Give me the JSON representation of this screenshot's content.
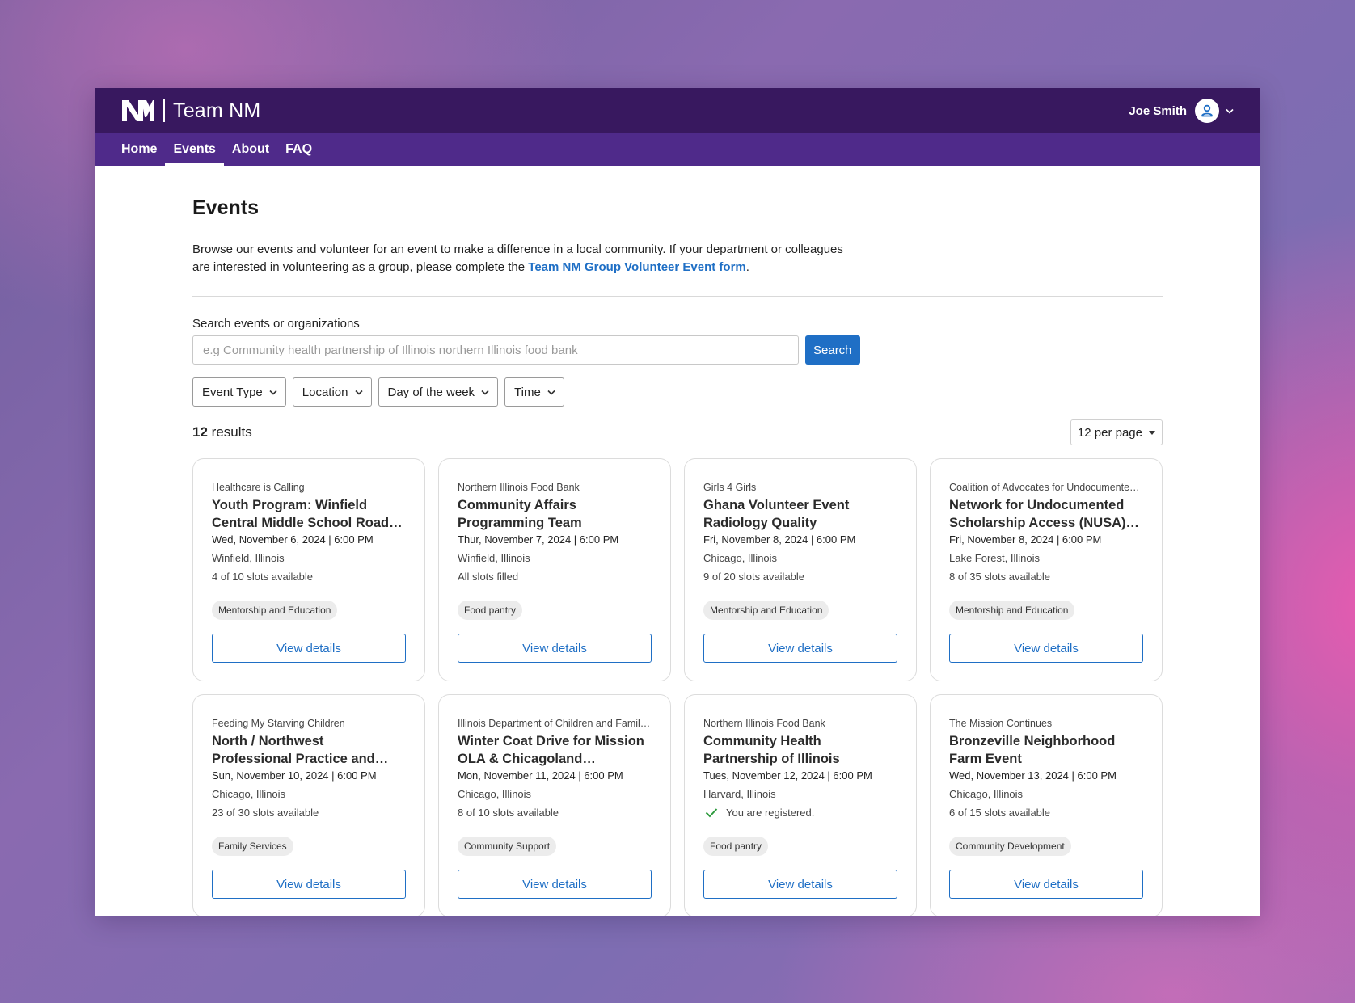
{
  "header": {
    "brand": "Team NM",
    "user_name": "Joe Smith"
  },
  "nav": [
    "Home",
    "Events",
    "About",
    "FAQ"
  ],
  "nav_active": "Events",
  "page": {
    "title": "Events",
    "intro_text": "Browse our events and volunteer for an event to make a difference in a local community. If your department or colleagues are interested in volunteering as a group, please complete the ",
    "intro_link": "Team NM Group Volunteer Event form",
    "intro_end": "."
  },
  "search": {
    "label": "Search events or organizations",
    "placeholder": "e.g Community health partnership of Illinois northern Illinois food bank",
    "button": "Search"
  },
  "filters": [
    "Event Type",
    "Location",
    "Day of the week",
    "Time"
  ],
  "results": {
    "count": "12",
    "label": "results",
    "per_page": "12 per page"
  },
  "events": [
    {
      "org": "Healthcare is Calling",
      "title": "Youth Program: Winfield Central Middle School Roads to Success Mentorship",
      "date": "Wed, November 6, 2024 | 6:00 PM",
      "location": "Winfield, Illinois",
      "slots": "4 of 10 slots available",
      "registered": false,
      "tag": "Mentorship and Education",
      "button": "View details"
    },
    {
      "org": "Northern Illinois Food Bank",
      "title": "Community Affairs Programming Team",
      "date": "Thur, November 7, 2024 | 6:00 PM",
      "location": "Winfield, Illinois",
      "slots": "All slots filled",
      "registered": false,
      "tag": "Food pantry",
      "button": "View details"
    },
    {
      "org": "Girls 4 Girls",
      "title": "Ghana Volunteer Event Radiology Quality",
      "date": "Fri, November 8, 2024 | 6:00 PM",
      "location": "Chicago, Illinois",
      "slots": "9 of 20 slots available",
      "registered": false,
      "tag": "Mentorship and Education",
      "button": "View details"
    },
    {
      "org": "Coalition of Advocates for Undocumented Students' Education",
      "title": "Network for Undocumented Scholarship Access (NUSA) Mentorship Program",
      "date": "Fri, November 8, 2024 | 6:00 PM",
      "location": "Lake Forest, Illinois",
      "slots": "8 of 35 slots available",
      "registered": false,
      "tag": "Mentorship and Education",
      "button": "View details"
    },
    {
      "org": "Feeding My Starving Children",
      "title": "North / Northwest Professional Practice and Development Council Event",
      "date": "Sun, November 10, 2024 | 6:00 PM",
      "location": "Chicago, Illinois",
      "slots": "23 of 30 slots available",
      "registered": false,
      "tag": "Family Services",
      "button": "View details"
    },
    {
      "org": "Illinois Department of Children and Family Services",
      "title": "Winter Coat Drive for Mission OLA & Chicagoland Organizations",
      "date": "Mon, November 11, 2024 | 6:00 PM",
      "location": "Chicago, Illinois",
      "slots": "8 of 10 slots available",
      "registered": false,
      "tag": "Community Support",
      "button": "View details"
    },
    {
      "org": "Northern Illinois Food Bank",
      "title": "Community Health Partnership of Illinois",
      "date": "Tues, November 12, 2024 | 6:00 PM",
      "location": "Harvard, Illinois",
      "slots": "You are registered.",
      "registered": true,
      "tag": "Food pantry",
      "button": "View details"
    },
    {
      "org": "The Mission Continues",
      "title": "Bronzeville Neighborhood Farm Event",
      "date": "Wed, November 13, 2024 | 6:00 PM",
      "location": "Chicago, Illinois",
      "slots": "6 of 15 slots available",
      "registered": false,
      "tag": "Community Development",
      "button": "View details"
    }
  ],
  "colors": {
    "topbar": "#38185f",
    "navbar": "#4f2a8a",
    "accent": "#1f6fc5",
    "success": "#2e9b3e"
  },
  "icons": {
    "logo": "nm-logo-icon",
    "avatar": "user-avatar-icon",
    "dropdown": "chevron-down-icon",
    "registered": "check-icon"
  }
}
